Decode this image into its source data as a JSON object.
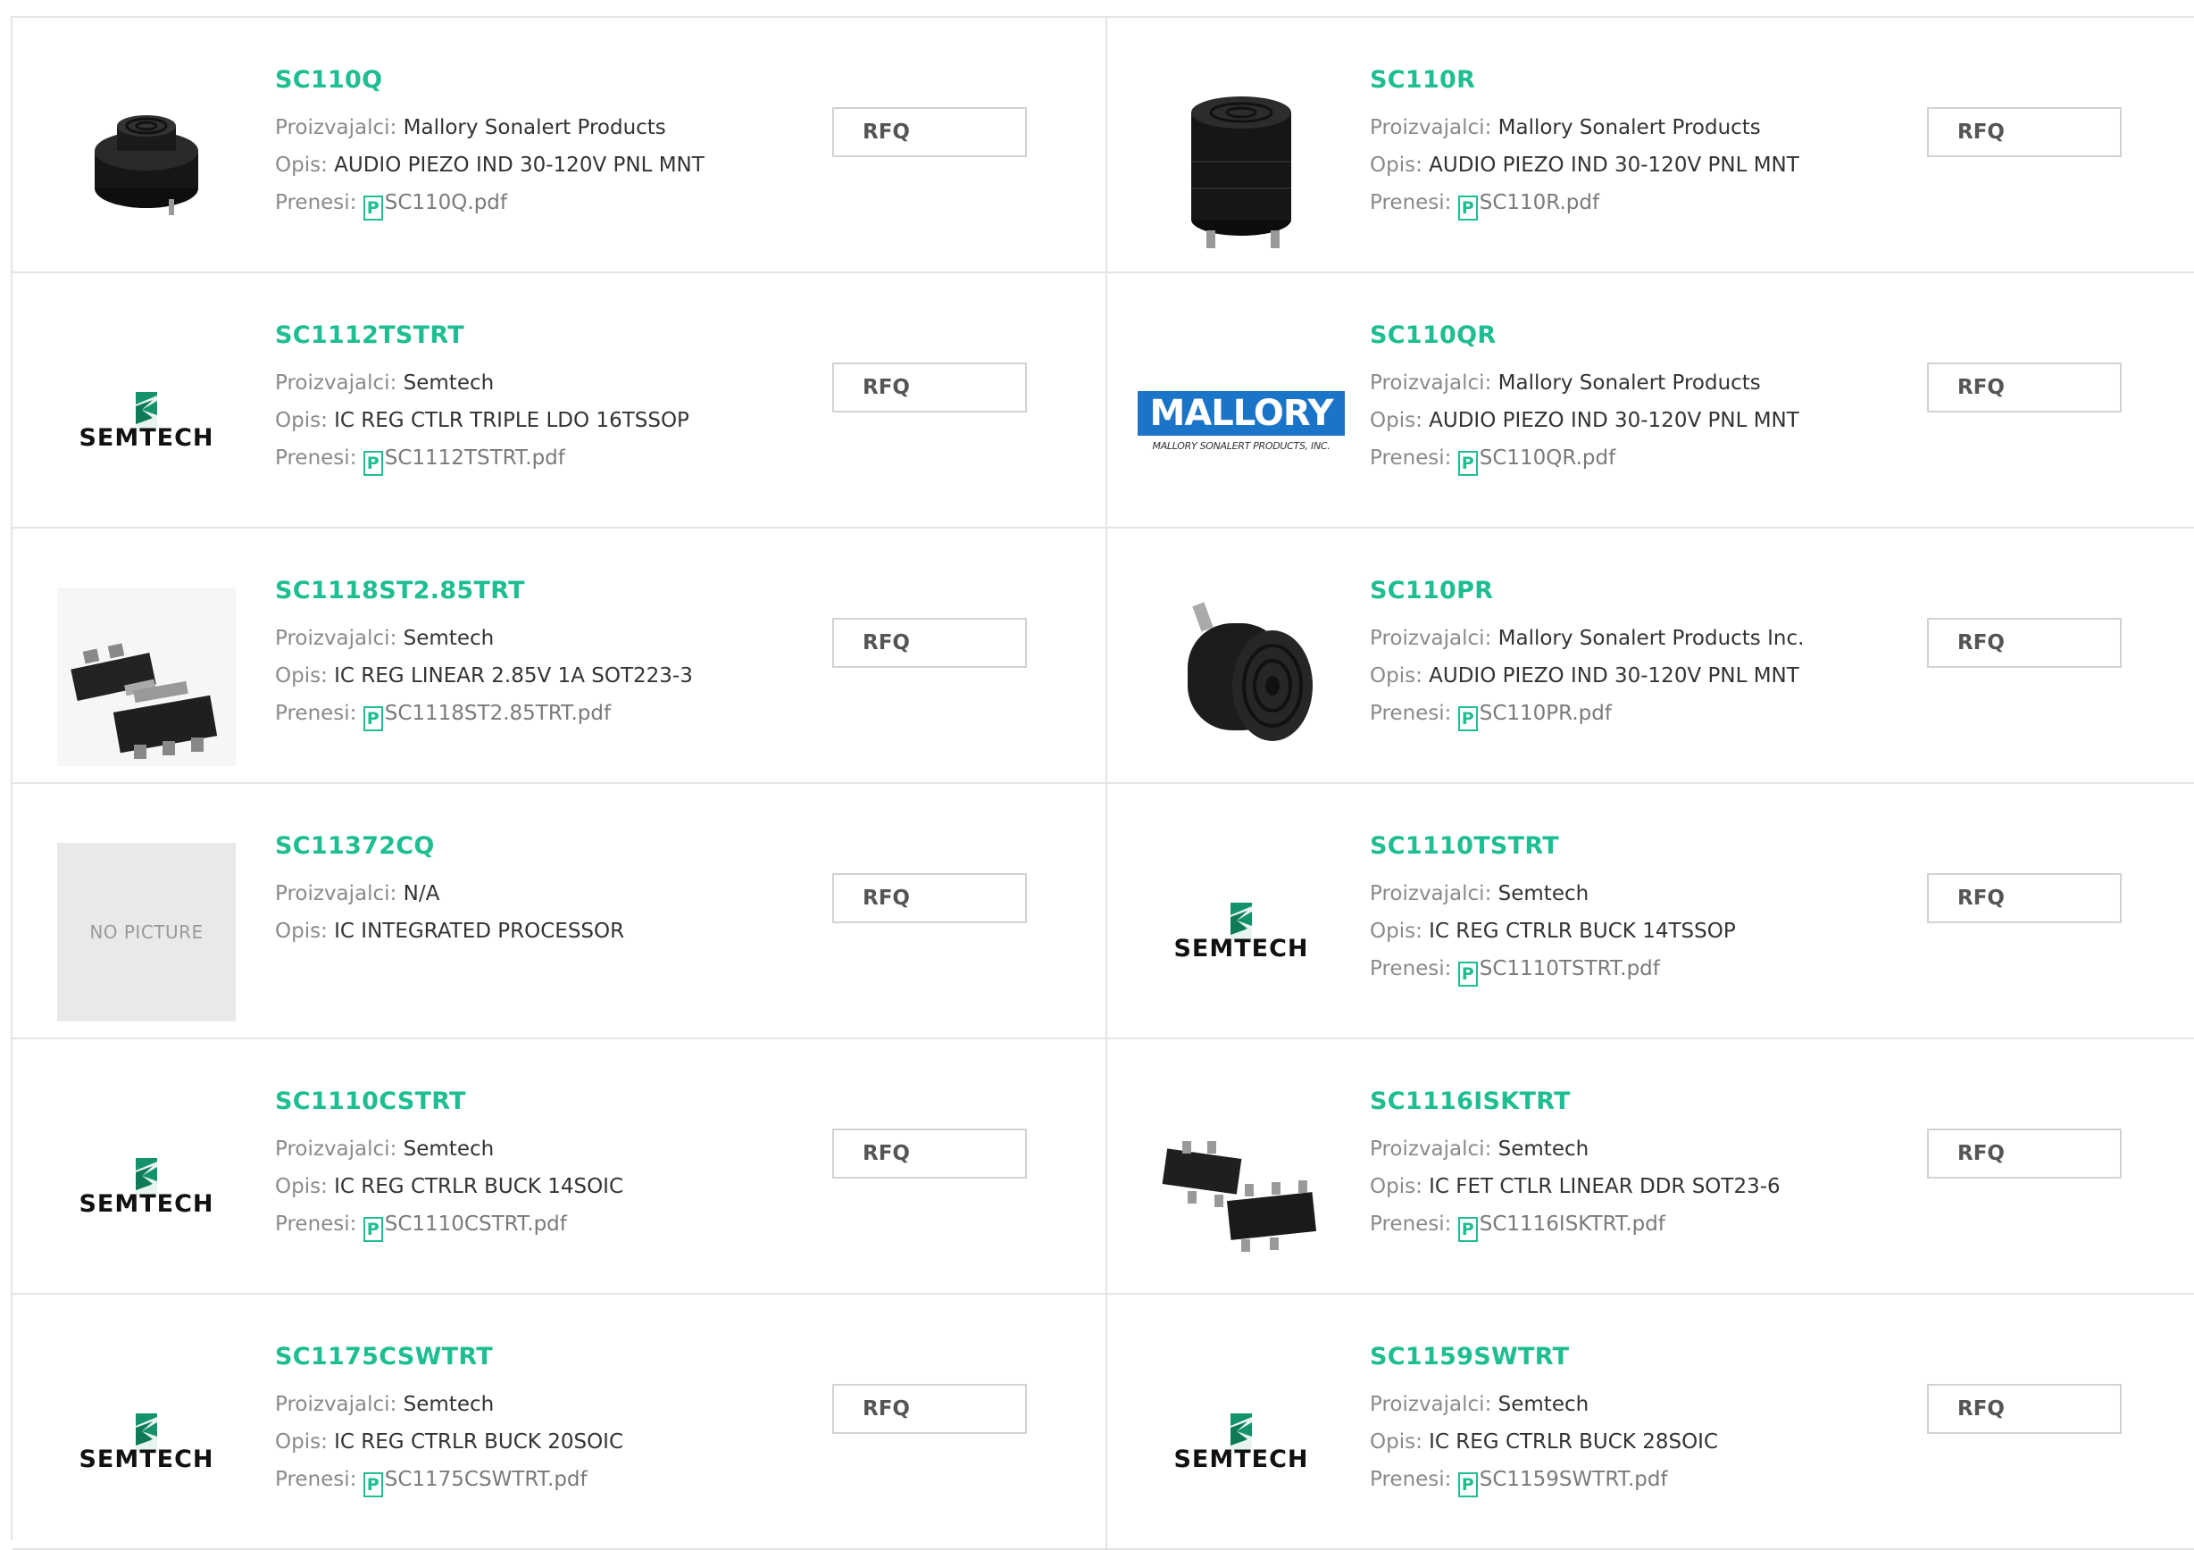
{
  "labels": {
    "manufacturer": "Proizvajalci:",
    "description": "Opis:",
    "download": "Prenesi:",
    "rfq": "RFQ",
    "pdf_icon": "P"
  },
  "icons": {
    "pdf": "pdf-file-icon",
    "accent": "#1ebe92"
  },
  "logos": {
    "semtech": "SEMTECH",
    "mallory_title": "MALLORY",
    "mallory_sub": "MALLORY SONALERT PRODUCTS, INC.",
    "no_picture": "NO PICTURE"
  },
  "products": [
    {
      "part": "SC110Q",
      "manufacturer": "Mallory Sonalert Products",
      "description": "AUDIO PIEZO IND 30-120V PNL MNT",
      "pdf": "SC110Q.pdf",
      "image": "buzzer-short"
    },
    {
      "part": "SC110R",
      "manufacturer": "Mallory Sonalert Products",
      "description": "AUDIO PIEZO IND 30-120V PNL MNT",
      "pdf": "SC110R.pdf",
      "image": "buzzer-tall"
    },
    {
      "part": "SC1112TSTRT",
      "manufacturer": "Semtech",
      "description": "IC REG CTLR TRIPLE LDO 16TSSOP",
      "pdf": "SC1112TSTRT.pdf",
      "image": "semtech-logo"
    },
    {
      "part": "SC110QR",
      "manufacturer": "Mallory Sonalert Products",
      "description": "AUDIO PIEZO IND 30-120V PNL MNT",
      "pdf": "SC110QR.pdf",
      "image": "mallory-logo"
    },
    {
      "part": "SC1118ST2.85TRT",
      "manufacturer": "Semtech",
      "description": "IC REG LINEAR 2.85V 1A SOT223-3",
      "pdf": "SC1118ST2.85TRT.pdf",
      "image": "sot223-chip"
    },
    {
      "part": "SC110PR",
      "manufacturer": "Mallory Sonalert Products Inc.",
      "description": "AUDIO PIEZO IND 30-120V PNL MNT",
      "pdf": "SC110PR.pdf",
      "image": "buzzer-side"
    },
    {
      "part": "SC11372CQ",
      "manufacturer": "N/A",
      "description": "IC INTEGRATED PROCESSOR",
      "pdf": null,
      "image": "no-picture"
    },
    {
      "part": "SC1110TSTRT",
      "manufacturer": "Semtech",
      "description": "IC REG CTRLR BUCK 14TSSOP",
      "pdf": "SC1110TSTRT.pdf",
      "image": "semtech-logo"
    },
    {
      "part": "SC1110CSTRT",
      "manufacturer": "Semtech",
      "description": "IC REG CTRLR BUCK 14SOIC",
      "pdf": "SC1110CSTRT.pdf",
      "image": "semtech-logo"
    },
    {
      "part": "SC1116ISKTRT",
      "manufacturer": "Semtech",
      "description": "IC FET CTLR LINEAR DDR SOT23-6",
      "pdf": "SC1116ISKTRT.pdf",
      "image": "sot23-chip"
    },
    {
      "part": "SC1175CSWTRT",
      "manufacturer": "Semtech",
      "description": "IC REG CTRLR BUCK 20SOIC",
      "pdf": "SC1175CSWTRT.pdf",
      "image": "semtech-logo"
    },
    {
      "part": "SC1159SWTRT",
      "manufacturer": "Semtech",
      "description": "IC REG CTRLR BUCK 28SOIC",
      "pdf": "SC1159SWTRT.pdf",
      "image": "semtech-logo"
    }
  ]
}
